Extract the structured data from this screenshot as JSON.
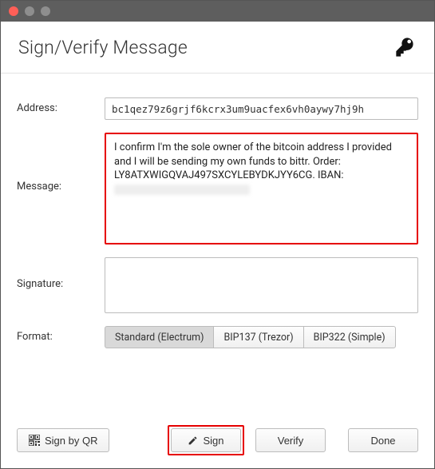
{
  "window": {
    "title": "Sign/Verify Message"
  },
  "labels": {
    "address": "Address:",
    "message": "Message:",
    "signature": "Signature:",
    "format": "Format:"
  },
  "fields": {
    "address": "bc1qez79z6grjf6kcrx3um9uacfex6vh0aywy7hj9h",
    "message": "I confirm I'm the sole owner of the bitcoin address I provided and I will be sending my own funds to bittr. Order: LY8ATXWIGQVAJ497SXCYLEBYDKJYY6CG. IBAN: ",
    "signature": ""
  },
  "format_options": {
    "standard": "Standard (Electrum)",
    "bip137": "BIP137 (Trezor)",
    "bip322": "BIP322 (Simple)"
  },
  "buttons": {
    "sign_by_qr": "Sign by QR",
    "sign": "Sign",
    "verify": "Verify",
    "done": "Done"
  }
}
